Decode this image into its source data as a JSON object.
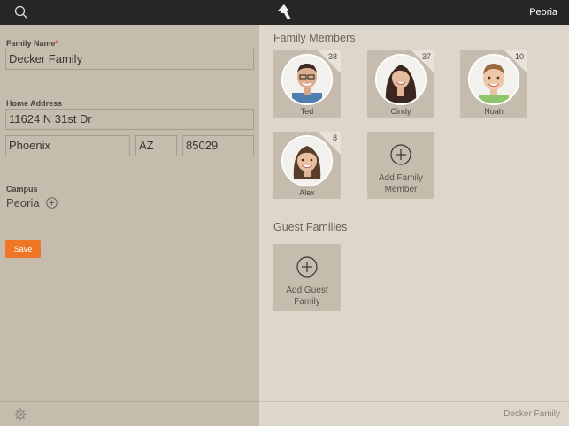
{
  "header": {
    "campus": "Peoria"
  },
  "form": {
    "family_name_label": "Family Name",
    "required_mark": "*",
    "family_name_value": "Decker Family",
    "home_address_label": "Home Address",
    "street_value": "11624 N 31st Dr",
    "city_value": "Phoenix",
    "state_value": "AZ",
    "zip_value": "85029",
    "campus_label": "Campus",
    "campus_value": "Peoria",
    "save_label": "Save"
  },
  "members": {
    "title": "Family Members",
    "items": [
      {
        "name": "Ted",
        "age": "38"
      },
      {
        "name": "Cindy",
        "age": "37"
      },
      {
        "name": "Noah",
        "age": "10"
      },
      {
        "name": "Alex",
        "age": "8"
      }
    ],
    "add_label": "Add Family Member"
  },
  "guests": {
    "title": "Guest Families",
    "add_label": "Add Guest Family"
  },
  "footer": {
    "family_name": "Decker Family"
  },
  "colors": {
    "topbar": "#262626",
    "left_panel": "#c6bcad",
    "right_panel": "#ddd6cb",
    "save_button": "#ee7624"
  }
}
